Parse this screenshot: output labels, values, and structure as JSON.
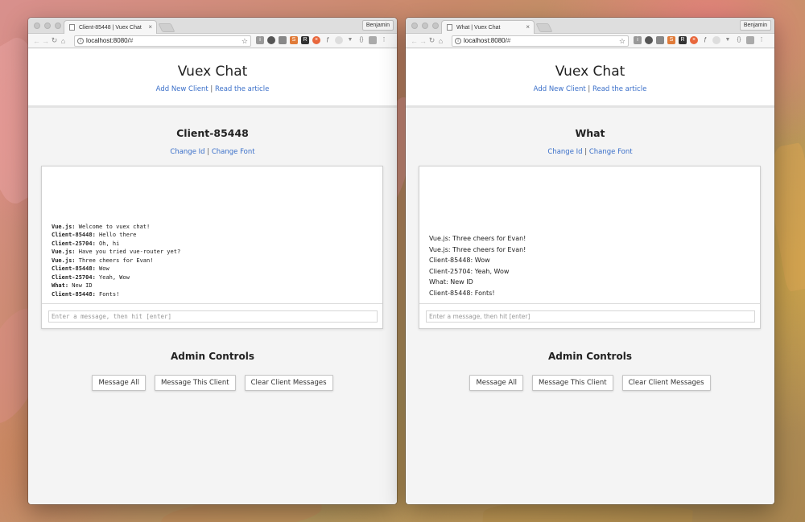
{
  "app": {
    "title": "Vuex Chat",
    "add_client_link": "Add New Client",
    "separator": "|",
    "article_link": "Read the article"
  },
  "browser": {
    "profile": "Benjamin",
    "url_host": "localhost:8080/",
    "url_hash": "#"
  },
  "windows": [
    {
      "tab_title": "Client-85448 | Vuex Chat",
      "client_title": "Client-85448",
      "change_id_link": "Change Id",
      "change_font_link": "Change Font",
      "font": "monospace",
      "messages": [
        {
          "author": "Vue.js:",
          "text": "Welcome to vuex chat!"
        },
        {
          "author": "Client-85448:",
          "text": "Hello there"
        },
        {
          "author": "Client-25704:",
          "text": "Oh, hi"
        },
        {
          "author": "Vue.js:",
          "text": "Have you tried vue-router yet?"
        },
        {
          "author": "Vue.js:",
          "text": "Three cheers for Evan!"
        },
        {
          "author": "Client-85448:",
          "text": "Wow"
        },
        {
          "author": "Client-25704:",
          "text": "Yeah, Wow"
        },
        {
          "author": "What:",
          "text": "New ID"
        },
        {
          "author": "Client-85448:",
          "text": "Fonts!"
        }
      ],
      "input_placeholder": "Enter a message, then hit [enter]"
    },
    {
      "tab_title": "What | Vuex Chat",
      "client_title": "What",
      "change_id_link": "Change Id",
      "change_font_link": "Change Font",
      "font": "sans",
      "messages": [
        {
          "author": "Vue.js:",
          "text": "Three cheers for Evan!"
        },
        {
          "author": "Vue.js:",
          "text": "Three cheers for Evan!"
        },
        {
          "author": "Client-85448:",
          "text": "Wow"
        },
        {
          "author": "Client-25704:",
          "text": "Yeah, Wow"
        },
        {
          "author": "What:",
          "text": "New ID"
        },
        {
          "author": "Client-85448:",
          "text": "Fonts!"
        }
      ],
      "input_placeholder": "Enter a message, then hit [enter]"
    }
  ],
  "admin": {
    "title": "Admin Controls",
    "message_all": "Message All",
    "message_this_client": "Message This Client",
    "clear_client_messages": "Clear Client Messages"
  },
  "colors": {
    "link": "#3a6fc9",
    "page_bg": "#f4f4f4",
    "header_bg": "#ffffff"
  },
  "icons": [
    "back-arrow-icon",
    "forward-arrow-icon",
    "reload-icon",
    "home-icon",
    "info-icon",
    "star-icon",
    "menu-icon"
  ]
}
